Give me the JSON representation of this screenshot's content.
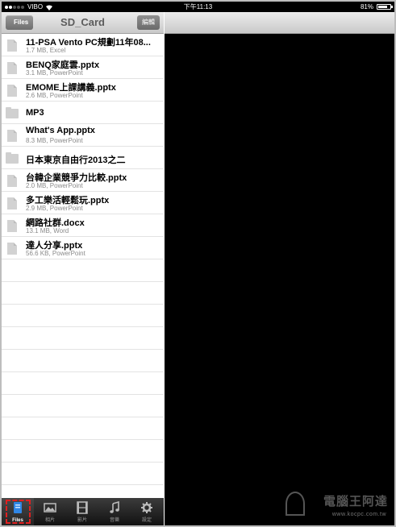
{
  "status_bar": {
    "carrier": "VIBO",
    "time": "下午11:13",
    "battery_text": "81%",
    "battery_level": 0.81
  },
  "nav": {
    "back_label": "Files",
    "title": "SD_Card",
    "edit_label": "編輯"
  },
  "files": [
    {
      "name": "11-PSA Vento PC規劃11年08...",
      "meta": "1.7 MB, Excel",
      "type": "file"
    },
    {
      "name": "BENQ家庭雲.pptx",
      "meta": "3.1 MB, PowerPoint",
      "type": "file"
    },
    {
      "name": "EMOME上課講義.pptx",
      "meta": "2.6 MB, PowerPoint",
      "type": "file"
    },
    {
      "name": "MP3",
      "meta": "",
      "type": "folder"
    },
    {
      "name": "What's App.pptx",
      "meta": "8.3 MB, PowerPoint",
      "type": "file"
    },
    {
      "name": "日本東京自由行2013之二",
      "meta": "",
      "type": "folder"
    },
    {
      "name": "台韓企業競爭力比較.pptx",
      "meta": "2.0 MB, PowerPoint",
      "type": "file"
    },
    {
      "name": "多工樂活輕鬆玩.pptx",
      "meta": "2.9 MB, PowerPoint",
      "type": "file"
    },
    {
      "name": "網路社群.docx",
      "meta": "13.1 MB, Word",
      "type": "file"
    },
    {
      "name": "達人分享.pptx",
      "meta": "56.6 KB, PowerPoint",
      "type": "file"
    }
  ],
  "tabs": [
    {
      "label": "Files",
      "icon": "files-icon",
      "active": true
    },
    {
      "label": "相片",
      "icon": "photos-icon",
      "active": false
    },
    {
      "label": "影片",
      "icon": "video-icon",
      "active": false
    },
    {
      "label": "音樂",
      "icon": "music-icon",
      "active": false
    },
    {
      "label": "設定",
      "icon": "settings-icon",
      "active": false
    }
  ],
  "watermark": {
    "text": "電腦王阿達",
    "url": "www.kocpc.com.tw"
  },
  "colors": {
    "selection_highlight": "#e02020",
    "tab_active_icon": "#2f86e6",
    "right_pane": "#000000"
  }
}
